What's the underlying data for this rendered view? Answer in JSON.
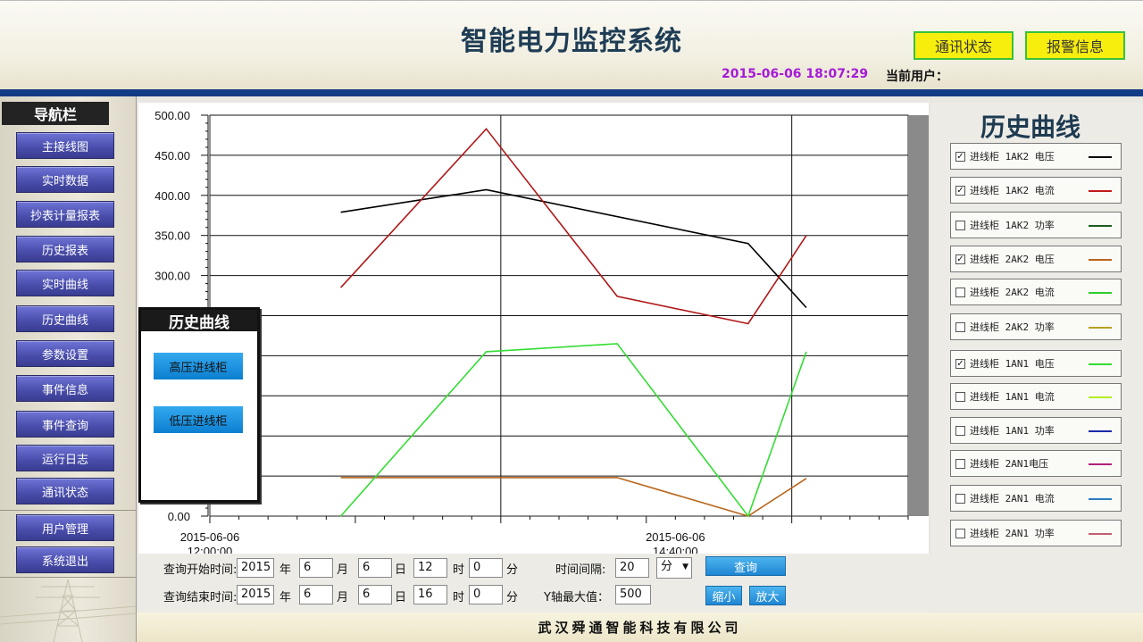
{
  "header": {
    "title": "智能电力监控系统",
    "comm_status_label": "通讯状态",
    "alarm_info_label": "报警信息",
    "datetime": "2015-06-06 18:07:29",
    "current_user_label": "当前用户："
  },
  "sidebar": {
    "title": "导航栏",
    "items": [
      "主接线图",
      "实时数据",
      "抄表计量报表",
      "历史报表",
      "实时曲线",
      "历史曲线",
      "参数设置",
      "事件信息",
      "事件查询",
      "运行日志",
      "通讯状态",
      "用户管理",
      "系统退出"
    ]
  },
  "popup": {
    "title": "历史曲线",
    "buttons": [
      "高压进线柜",
      "低压进线柜"
    ]
  },
  "legend": {
    "title": "历史曲线",
    "items": [
      {
        "label": "进线柜 1AK2 电压",
        "checked": true,
        "color": "#000000"
      },
      {
        "label": "进线柜 1AK2 电流",
        "checked": true,
        "color": "#c01a1a"
      },
      {
        "label": "进线柜 1AK2 功率",
        "checked": false,
        "color": "#1e5b1e"
      },
      {
        "label": "进线柜 2AK2 电压",
        "checked": true,
        "color": "#b8651a"
      },
      {
        "label": "进线柜 2AK2 电流",
        "checked": false,
        "color": "#2ecc2e"
      },
      {
        "label": "进线柜 2AK2 功率",
        "checked": false,
        "color": "#b8a020"
      },
      {
        "label": "进线柜 1AN1 电压",
        "checked": true,
        "color": "#33dd33"
      },
      {
        "label": "进线柜 1AN1 电流",
        "checked": false,
        "color": "#b3ee22"
      },
      {
        "label": "进线柜 1AN1 功率",
        "checked": false,
        "color": "#1a2aa8"
      },
      {
        "label": "进线柜 2AN1电压",
        "checked": false,
        "color": "#b0207a"
      },
      {
        "label": "进线柜 2AN1 电流",
        "checked": false,
        "color": "#2a7ec0"
      },
      {
        "label": "进线柜 2AN1 功率",
        "checked": false,
        "color": "#c06070"
      }
    ]
  },
  "chart_data": {
    "type": "line",
    "ylim": [
      0,
      500
    ],
    "y_ticks": [
      0,
      50,
      100,
      150,
      200,
      250,
      300,
      350,
      400,
      450,
      500
    ],
    "y_tick_labels": {
      "0": "0.00",
      "300": "300.00",
      "350": "350.00",
      "400": "400.00",
      "450": "450.00",
      "500": "500.00"
    },
    "x_tick_labels": [
      {
        "line1": "2015-06-06",
        "line2": "12:00:00",
        "t": 0
      },
      {
        "line1": "2015-06-06",
        "line2": "14:40:00",
        "t": 160
      }
    ],
    "xlim": [
      0,
      240
    ],
    "series": [
      {
        "color": "#000000",
        "points": [
          [
            45,
            379
          ],
          [
            95,
            407
          ],
          [
            185,
            340
          ],
          [
            205,
            260
          ]
        ]
      },
      {
        "color": "#b01818",
        "points": [
          [
            45,
            285
          ],
          [
            95,
            483
          ],
          [
            140,
            274
          ],
          [
            185,
            240
          ],
          [
            205,
            350
          ]
        ]
      },
      {
        "color": "#b8651a",
        "points": [
          [
            45,
            48
          ],
          [
            140,
            48
          ],
          [
            185,
            0
          ],
          [
            205,
            47
          ]
        ]
      },
      {
        "color": "#33dd33",
        "points": [
          [
            45,
            0
          ],
          [
            95,
            205
          ],
          [
            140,
            215
          ],
          [
            185,
            0
          ],
          [
            205,
            205
          ]
        ]
      }
    ]
  },
  "query": {
    "start_label": "查询开始时间:",
    "end_label": "查询结束时间:",
    "start": {
      "year": "2015",
      "month": "6",
      "day": "6",
      "hour": "12",
      "minute": "0"
    },
    "end": {
      "year": "2015",
      "month": "6",
      "day": "6",
      "hour": "16",
      "minute": "0"
    },
    "unit_year": "年",
    "unit_month": "月",
    "unit_day": "日",
    "unit_hour": "时",
    "unit_minute": "分",
    "interval_label": "时间间隔:",
    "interval_value": "20",
    "interval_unit": "分",
    "ymax_label": "Y轴最大值：",
    "ymax_value": "500",
    "query_button": "查询",
    "zoom_out_button": "缩小",
    "zoom_in_button": "放大"
  },
  "footer": {
    "company": "武汉舜通智能科技有限公司"
  }
}
